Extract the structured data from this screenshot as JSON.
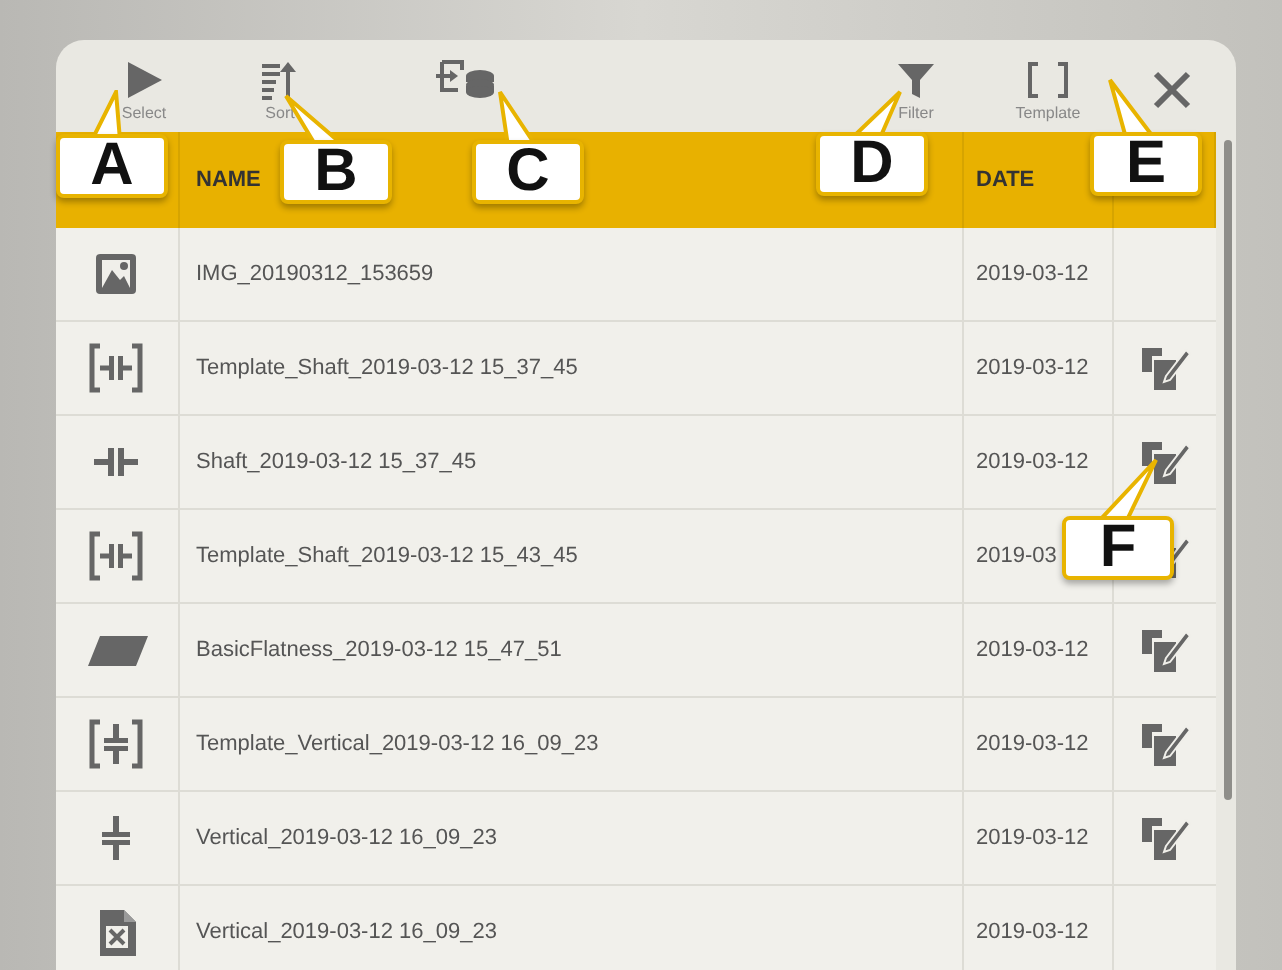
{
  "toolbar": [
    {
      "kind": "select",
      "label": "Select"
    },
    {
      "kind": "sort",
      "label": "Sort"
    },
    {
      "kind": "import"
    },
    {
      "kind": "filter",
      "label": "Filter"
    },
    {
      "kind": "template",
      "label": "Template"
    },
    {
      "kind": "close"
    }
  ],
  "table": {
    "columns": [
      "NAME",
      "DATE"
    ],
    "rows": [
      {
        "kind": "image",
        "name": "IMG_20190312_153659",
        "date": "2019-03-12",
        "editable": false
      },
      {
        "kind": "template-shaft",
        "name": "Template_Shaft_2019-03-12 15_37_45",
        "date": "2019-03-12",
        "editable": true
      },
      {
        "kind": "shaft",
        "name": "Shaft_2019-03-12 15_37_45",
        "date": "2019-03-12",
        "editable": true
      },
      {
        "kind": "template-shaft",
        "name": "Template_Shaft_2019-03-12 15_43_45",
        "date": "2019-03",
        "editable": true
      },
      {
        "kind": "flatness",
        "name": "BasicFlatness_2019-03-12 15_47_51",
        "date": "2019-03-12",
        "editable": true
      },
      {
        "kind": "template-vertical",
        "name": "Template_Vertical_2019-03-12 16_09_23",
        "date": "2019-03-12",
        "editable": true
      },
      {
        "kind": "vertical",
        "name": "Vertical_2019-03-12 16_09_23",
        "date": "2019-03-12",
        "editable": true
      },
      {
        "kind": "spreadsheet",
        "name": "Vertical_2019-03-12 16_09_23",
        "date": "2019-03-12",
        "editable": false
      }
    ]
  },
  "callouts": [
    {
      "label": "A"
    },
    {
      "label": "B"
    },
    {
      "label": "C"
    },
    {
      "label": "D"
    },
    {
      "label": "E"
    },
    {
      "label": "F"
    }
  ]
}
